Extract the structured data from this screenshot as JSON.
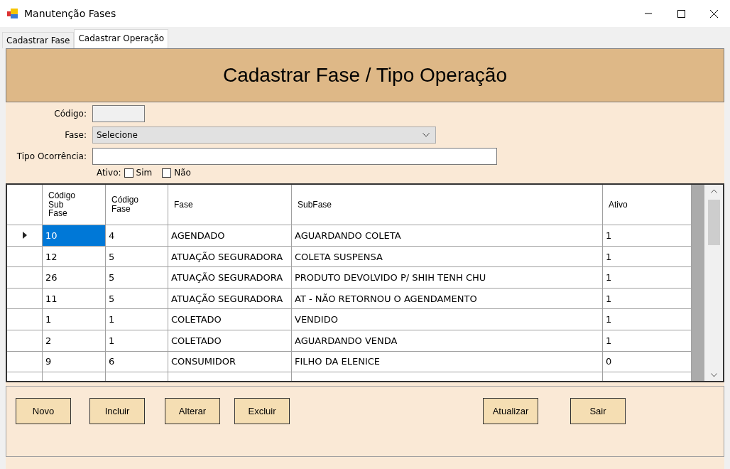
{
  "window": {
    "title": "Manutenção Fases"
  },
  "tabs": [
    {
      "label": "Cadastrar Fase",
      "selected": false
    },
    {
      "label": "Cadastrar Operação",
      "selected": true
    }
  ],
  "header": {
    "title": "Cadastrar Fase / Tipo Operação"
  },
  "form": {
    "codigo": {
      "label": "Código:"
    },
    "fase": {
      "label": "Fase:",
      "value": "Selecione"
    },
    "tipo": {
      "label": "Tipo Ocorrência:"
    },
    "ativo": {
      "label": "Ativo:",
      "options": [
        {
          "label": "Sim",
          "checked": false
        },
        {
          "label": "Não",
          "checked": false
        }
      ]
    }
  },
  "table": {
    "columns": [
      "Código Sub Fase",
      "Código Fase",
      "Fase",
      "SubFase",
      "Ativo"
    ],
    "rows": [
      {
        "selected": true,
        "cells": [
          "10",
          "4",
          "AGENDADO",
          "AGUARDANDO COLETA",
          "1"
        ]
      },
      {
        "selected": false,
        "cells": [
          "12",
          "5",
          "ATUAÇÃO SEGURADORA",
          "COLETA SUSPENSA",
          "1"
        ]
      },
      {
        "selected": false,
        "cells": [
          "26",
          "5",
          "ATUAÇÃO SEGURADORA",
          "PRODUTO DEVOLVIDO P/ SHIH TENH CHU",
          "1"
        ]
      },
      {
        "selected": false,
        "cells": [
          "11",
          "5",
          "ATUAÇÃO SEGURADORA",
          "AT - NÃO RETORNOU O AGENDAMENTO",
          "1"
        ]
      },
      {
        "selected": false,
        "cells": [
          "1",
          "1",
          "COLETADO",
          "VENDIDO",
          "1"
        ]
      },
      {
        "selected": false,
        "cells": [
          "2",
          "1",
          "COLETADO",
          "AGUARDANDO VENDA",
          "1"
        ]
      },
      {
        "selected": false,
        "cells": [
          "9",
          "6",
          "CONSUMIDOR",
          "FILHO DA ELENICE",
          "0"
        ]
      }
    ]
  },
  "buttons_left": [
    "Novo",
    "Incluir",
    "Alterar",
    "Excluir"
  ],
  "buttons_right": [
    "Atualizar",
    "Sair"
  ]
}
